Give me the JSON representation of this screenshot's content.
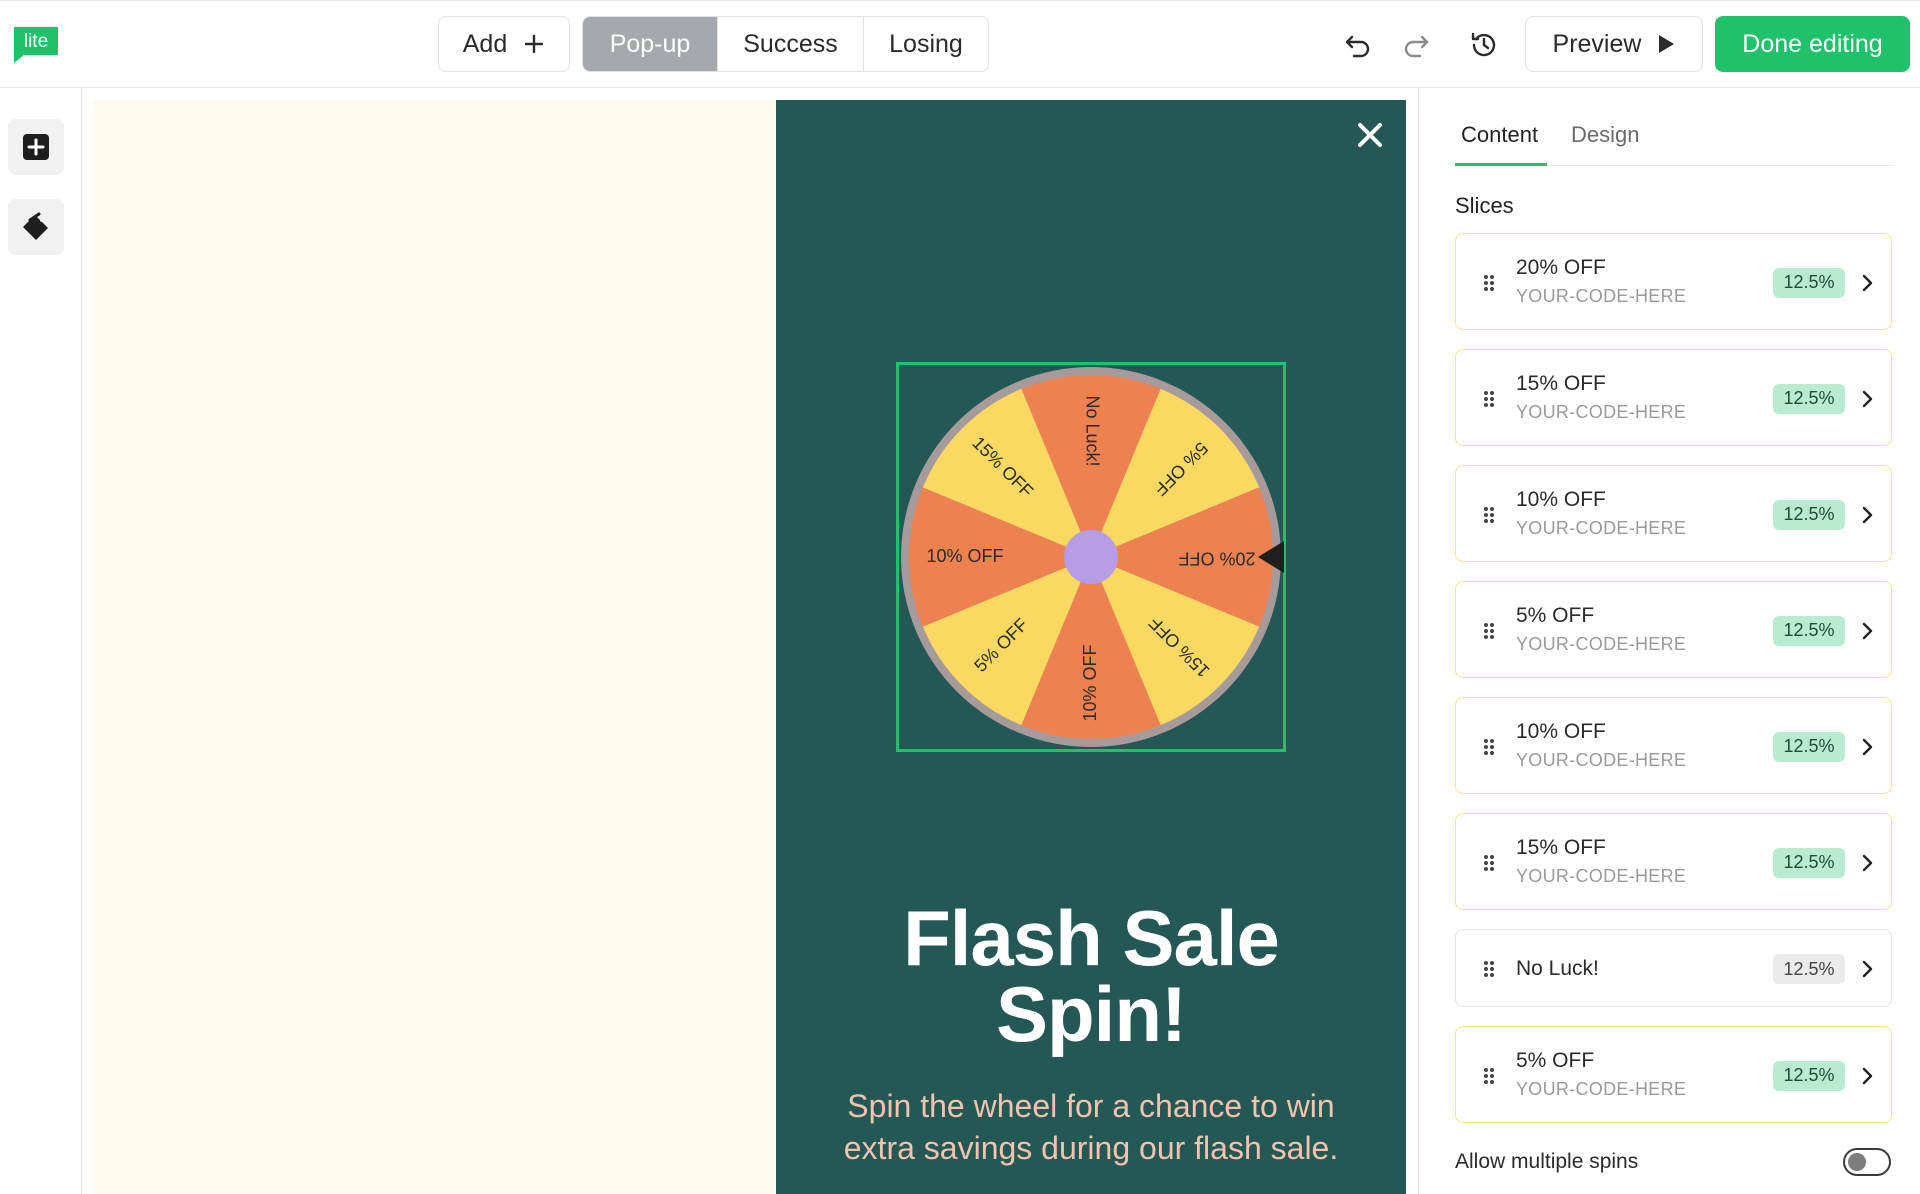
{
  "app": {
    "logo_text": "lite"
  },
  "toolbar": {
    "add_label": "Add",
    "tabs": [
      {
        "label": "Pop-up"
      },
      {
        "label": "Success"
      },
      {
        "label": "Losing"
      }
    ],
    "preview_label": "Preview",
    "done_label": "Done editing"
  },
  "popup": {
    "title_line1": "Flash Sale",
    "title_line2": "Spin!",
    "subtitle_line1": "Spin the wheel for a chance to win",
    "subtitle_line2": "extra savings during our flash sale.",
    "wheel_labels": [
      "No Luck!",
      "5% OFF",
      "20% OFF",
      "15% OFF",
      "10% OFF",
      "5% OFF",
      "10% OFF",
      "15% OFF"
    ],
    "colors": {
      "orange": "#ee8150",
      "yellow": "#f9d962",
      "hub": "#b79ce6",
      "bg": "#245854",
      "rim": "#a79a9a"
    }
  },
  "panel": {
    "tabs": [
      {
        "label": "Content"
      },
      {
        "label": "Design"
      }
    ],
    "slices_label": "Slices",
    "slices": [
      {
        "name": "20% OFF",
        "code": "YOUR-CODE-HERE",
        "pct": "12.5%"
      },
      {
        "name": "15% OFF",
        "code": "YOUR-CODE-HERE",
        "pct": "12.5%"
      },
      {
        "name": "10% OFF",
        "code": "YOUR-CODE-HERE",
        "pct": "12.5%"
      },
      {
        "name": "5% OFF",
        "code": "YOUR-CODE-HERE",
        "pct": "12.5%"
      },
      {
        "name": "10% OFF",
        "code": "YOUR-CODE-HERE",
        "pct": "12.5%"
      },
      {
        "name": "15% OFF",
        "code": "YOUR-CODE-HERE",
        "pct": "12.5%"
      },
      {
        "name": "No Luck!",
        "code": "",
        "pct": "12.5%"
      },
      {
        "name": "5% OFF",
        "code": "YOUR-CODE-HERE",
        "pct": "12.5%"
      }
    ],
    "allow_multiple_label": "Allow multiple spins",
    "allow_multiple": false
  }
}
